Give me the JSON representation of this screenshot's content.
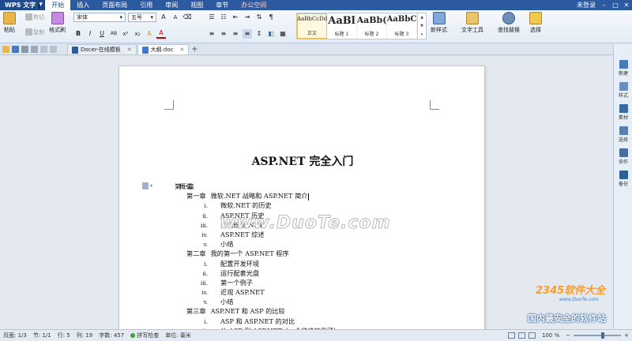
{
  "app": {
    "name": "WPS 文字"
  },
  "menu": [
    "开始",
    "插入",
    "页面布局",
    "引用",
    "审阅",
    "视图",
    "章节",
    "办公空间"
  ],
  "menubar_right": {
    "login": "未登录"
  },
  "ribbon": {
    "paste": "粘贴",
    "cut": "剪切",
    "copy": "复制",
    "format_painter": "格式刷",
    "font_name": "宋体",
    "font_size": "五号",
    "styles": [
      {
        "preview": "AaBbCcDd",
        "label": "正文"
      },
      {
        "preview": "AaBl",
        "label": "标题 1"
      },
      {
        "preview": "AaBb(",
        "label": "标题 2"
      },
      {
        "preview": "AaBbC",
        "label": "标题 3"
      }
    ],
    "new_style": "新样式",
    "text_tools": "文字工具",
    "find_replace": "查找替换",
    "select": "选择"
  },
  "tabs": [
    {
      "label": "Docer-在线模板",
      "active": false
    },
    {
      "label": "大纲.doc",
      "active": true
    }
  ],
  "document": {
    "title": "ASP.NET 完全入门",
    "outline": [
      {
        "level": 1,
        "num": "第一篇",
        "text": "概论"
      },
      {
        "level": 2,
        "num": "第一章",
        "text": "微软.NET 战略和 ASP.NET 简介"
      },
      {
        "level": 3,
        "num": "i.",
        "text": "微软.NET 的历史"
      },
      {
        "level": 3,
        "num": "ii.",
        "text": "ASP.NET 历史"
      },
      {
        "level": 3,
        "num": "iii.",
        "text": "众说纷纭.NET"
      },
      {
        "level": 3,
        "num": "iv.",
        "text": "ASP.NET 综述"
      },
      {
        "level": 3,
        "num": "v.",
        "text": "小结"
      },
      {
        "level": 2,
        "num": "第二章",
        "text": "我的第一个 ASP.NET 程序"
      },
      {
        "level": 3,
        "num": "i.",
        "text": "配置开发环境"
      },
      {
        "level": 3,
        "num": "ii.",
        "text": "运行配套光盘"
      },
      {
        "level": 3,
        "num": "iii.",
        "text": "第一个例子"
      },
      {
        "level": 3,
        "num": "iv.",
        "text": "近观 ASP.NET"
      },
      {
        "level": 3,
        "num": "v.",
        "text": "小结"
      },
      {
        "level": 2,
        "num": "第三章",
        "text": "ASP.NET 和 ASP 的比较"
      },
      {
        "level": 3,
        "num": "i.",
        "text": "ASP 和 ASP.NET 的对比"
      },
      {
        "level": 3,
        "num": "ii.",
        "text": "从 ASP 到 ASP.NET（一个移植的例子）"
      }
    ]
  },
  "sidebar": [
    "新建",
    "样式",
    "素材",
    "选择",
    "协作",
    "备份"
  ],
  "status": {
    "page": "页面: 1/3",
    "section": "节: 1/1",
    "row": "行: 5",
    "col": "列: 19",
    "words": "字数: 457",
    "spell": "拼写检查",
    "unit": "单位: 毫米",
    "zoom": "100 %"
  },
  "watermarks": {
    "main": "www.DuoTe.com",
    "brand": "2345软件大全",
    "url": "www.DuoTe.com",
    "slogan": "国内最安全的软件站"
  },
  "colors": {
    "menubar": "#2c5aa0",
    "accent": "#1f4b8e"
  }
}
